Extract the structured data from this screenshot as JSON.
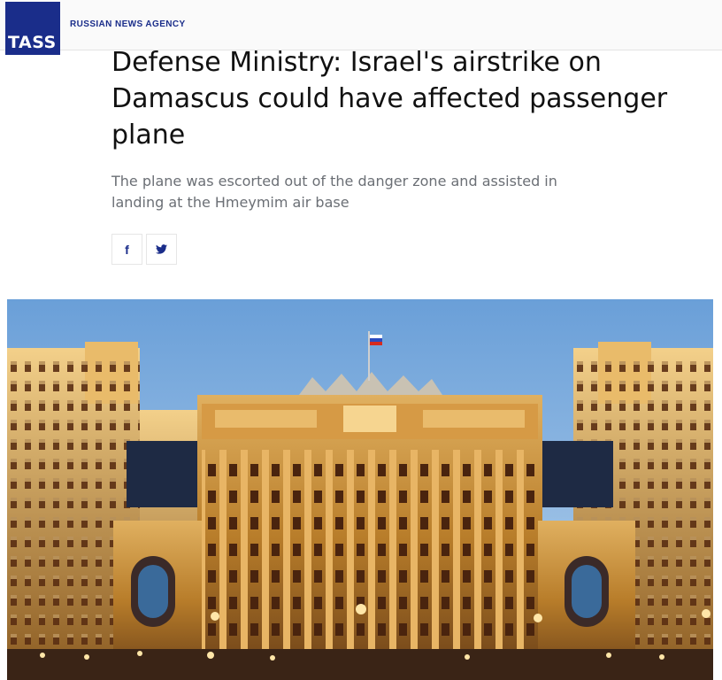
{
  "header": {
    "logo_text": "TASS",
    "agency_label": "RUSSIAN NEWS AGENCY"
  },
  "article": {
    "headline": "Defense Ministry: Israel's airstrike on Damascus could have affected passenger plane",
    "subtitle": "The plane was escorted out of the danger zone and assisted in landing at the Hmeymim air base"
  },
  "share": {
    "facebook_icon": "f",
    "twitter_icon": "twitter-bird"
  },
  "image": {
    "subject": "Russian Defense Ministry building at dusk",
    "colors": {
      "sky_top": "#6a9fd8",
      "sky_bottom": "#b8d4ee",
      "facade": "#c9902f",
      "facade_light": "#f3d08a"
    }
  },
  "colors": {
    "brand": "#1a2d8a",
    "subtitle": "#6b6f75"
  }
}
